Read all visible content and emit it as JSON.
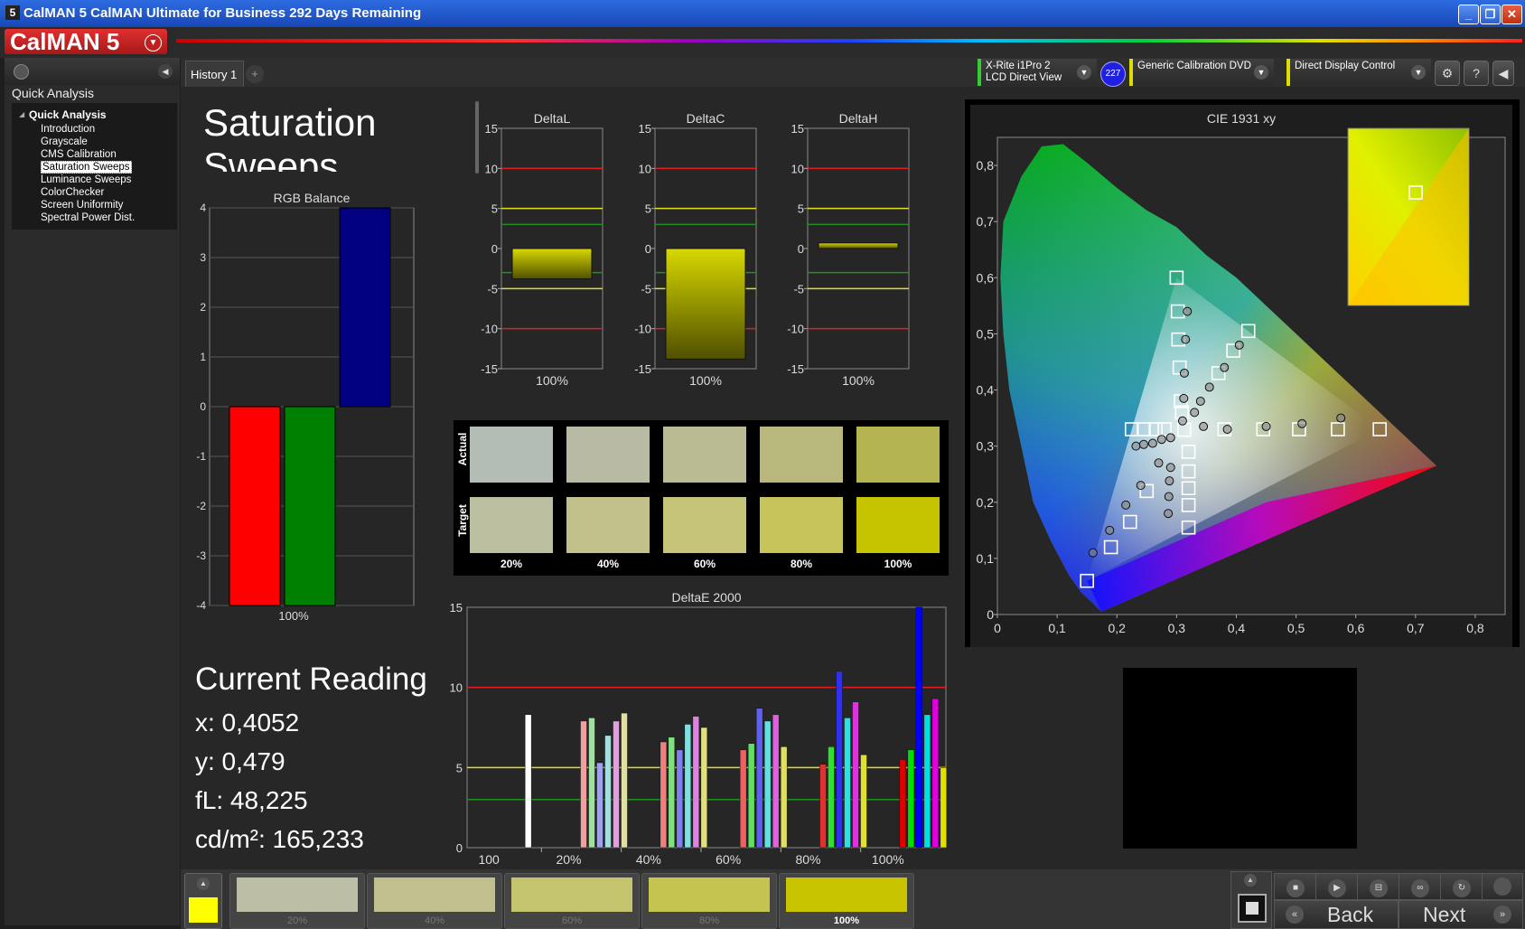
{
  "window": {
    "title": "CalMAN 5 CalMAN Ultimate for Business 292 Days Remaining",
    "icon_text": "5",
    "controls": [
      "minimize-icon",
      "restore-icon",
      "close-icon"
    ]
  },
  "app": {
    "logo": "CalMAN 5",
    "logo_dropdown_icon": "chevron-down-icon"
  },
  "sidebar": {
    "heading": "Quick Analysis",
    "tree_root": "Quick Analysis",
    "items": [
      {
        "label": "Introduction",
        "selected": false
      },
      {
        "label": "Grayscale",
        "selected": false
      },
      {
        "label": "CMS Calibration",
        "selected": false
      },
      {
        "label": "Saturation Sweeps",
        "selected": true
      },
      {
        "label": "Luminance Sweeps",
        "selected": false
      },
      {
        "label": "ColorChecker",
        "selected": false
      },
      {
        "label": "Screen Uniformity",
        "selected": false
      },
      {
        "label": "Spectral Power Dist.",
        "selected": false
      }
    ]
  },
  "tabs": {
    "history": "History 1",
    "add": "+"
  },
  "devices": {
    "meter_line1": "X-Rite i1Pro 2",
    "meter_line2": "LCD Direct View",
    "meter_badge": "227",
    "source": "Generic Calibration DVD",
    "display": "Direct Display Control",
    "icons": [
      "gear-icon",
      "help-icon",
      "collapse-icon"
    ],
    "help_label": "?"
  },
  "page": {
    "title": "Saturation Sweeps",
    "reading_title": "Current Reading",
    "readings": {
      "x": "x: 0,4052",
      "y": "y: 0,479",
      "fL": "fL: 48,225",
      "cdm2": "cd/m²: 165,233"
    }
  },
  "chart_data": [
    {
      "id": "rgb_balance",
      "type": "bar",
      "title": "RGB Balance",
      "categories": [
        "100%"
      ],
      "ylim": [
        -4,
        4
      ],
      "yticks": [
        "4",
        "3",
        "2",
        "1",
        "0",
        "-1",
        "-2",
        "-3",
        "-4"
      ],
      "series": [
        {
          "color": "#ff0000",
          "values": [
            -4.0
          ]
        },
        {
          "color": "#008000",
          "values": [
            -4.0
          ]
        },
        {
          "color": "#000080",
          "values": [
            4.0
          ]
        }
      ]
    },
    {
      "id": "delta_l",
      "type": "bar",
      "title": "DeltaL",
      "categories": [
        "100%"
      ],
      "values": [
        -3.8
      ],
      "ylim": [
        -15,
        15
      ],
      "yticks": [
        "15",
        "10",
        "5",
        "0",
        "-5",
        "-10",
        "-15"
      ]
    },
    {
      "id": "delta_c",
      "type": "bar",
      "title": "DeltaC",
      "categories": [
        "100%"
      ],
      "values": [
        -13.8
      ],
      "ylim": [
        -15,
        15
      ],
      "yticks": [
        "15",
        "10",
        "5",
        "0",
        "-5",
        "-10",
        "-15"
      ]
    },
    {
      "id": "delta_h",
      "type": "bar",
      "title": "DeltaH",
      "categories": [
        "100%"
      ],
      "values": [
        0.7
      ],
      "ylim": [
        -15,
        15
      ],
      "yticks": [
        "15",
        "10",
        "5",
        "0",
        "-5",
        "-10",
        "-15"
      ]
    },
    {
      "id": "delta_e_2000",
      "type": "bar",
      "title": "DeltaE 2000",
      "categories": [
        "100",
        "20%",
        "40%",
        "60%",
        "80%",
        "100%"
      ],
      "ylim": [
        0,
        15
      ],
      "yticks": [
        "15",
        "10",
        "5",
        "0"
      ],
      "groups": [
        {
          "colors": [
            "#ffffff"
          ],
          "values": [
            8.3
          ]
        },
        {
          "colors": [
            "#f0a0a0",
            "#a0e0a0",
            "#a0a0f0",
            "#a0e0e0",
            "#e0a0e0",
            "#e0e0a0"
          ],
          "values": [
            7.9,
            8.1,
            5.3,
            7.0,
            7.9,
            8.4
          ]
        },
        {
          "colors": [
            "#f08080",
            "#80e080",
            "#8080f0",
            "#80e0e0",
            "#e080e0",
            "#e0e080"
          ],
          "values": [
            6.6,
            6.9,
            6.1,
            7.7,
            8.2,
            7.5
          ]
        },
        {
          "colors": [
            "#f06060",
            "#60e060",
            "#6060f0",
            "#60e0e0",
            "#e060e0",
            "#e0e060"
          ],
          "values": [
            6.1,
            6.5,
            8.7,
            7.9,
            8.3,
            6.3
          ]
        },
        {
          "colors": [
            "#e03030",
            "#30e030",
            "#3030f0",
            "#30e0e0",
            "#e030e0",
            "#e0e030"
          ],
          "values": [
            5.2,
            6.3,
            11.0,
            8.1,
            9.1,
            5.8
          ]
        },
        {
          "colors": [
            "#e00000",
            "#00e000",
            "#0000ff",
            "#00e0e0",
            "#e000e0",
            "#e0e000"
          ],
          "values": [
            5.5,
            6.1,
            15.0,
            8.3,
            9.3,
            5.0
          ]
        }
      ]
    },
    {
      "id": "cie_1931_xy",
      "type": "scatter",
      "title": "CIE 1931 xy",
      "xlim": [
        0,
        0.85
      ],
      "ylim": [
        0,
        0.85
      ],
      "xticks": [
        "0",
        "0,1",
        "0,2",
        "0,3",
        "0,4",
        "0,5",
        "0,6",
        "0,7",
        "0,8"
      ],
      "yticks": [
        "0,8",
        "0,7",
        "0,6",
        "0,5",
        "0,4",
        "0,3",
        "0,2",
        "0,1",
        "0"
      ],
      "series": [
        {
          "marker": "square",
          "points": [
            [
              0.3127,
              0.329
            ],
            [
              0.64,
              0.33
            ],
            [
              0.57,
              0.33
            ],
            [
              0.505,
              0.33
            ],
            [
              0.445,
              0.33
            ],
            [
              0.38,
              0.33
            ],
            [
              0.3,
              0.6
            ],
            [
              0.302,
              0.54
            ],
            [
              0.303,
              0.49
            ],
            [
              0.305,
              0.44
            ],
            [
              0.307,
              0.38
            ],
            [
              0.309,
              0.36
            ],
            [
              0.15,
              0.06
            ],
            [
              0.19,
              0.12
            ],
            [
              0.222,
              0.165
            ],
            [
              0.25,
              0.22
            ],
            [
              0.28,
              0.33
            ],
            [
              0.265,
              0.33
            ],
            [
              0.245,
              0.33
            ],
            [
              0.225,
              0.33
            ],
            [
              0.42,
              0.505
            ],
            [
              0.395,
              0.47
            ],
            [
              0.37,
              0.43
            ],
            [
              0.32,
              0.155
            ],
            [
              0.32,
              0.195
            ],
            [
              0.32,
              0.225
            ],
            [
              0.32,
              0.255
            ],
            [
              0.32,
              0.29
            ]
          ]
        },
        {
          "marker": "circle",
          "points": [
            [
              0.318,
              0.54
            ],
            [
              0.315,
              0.49
            ],
            [
              0.313,
              0.43
            ],
            [
              0.312,
              0.385
            ],
            [
              0.31,
              0.345
            ],
            [
              0.345,
              0.335
            ],
            [
              0.385,
              0.33
            ],
            [
              0.45,
              0.335
            ],
            [
              0.51,
              0.34
            ],
            [
              0.575,
              0.35
            ],
            [
              0.232,
              0.3
            ],
            [
              0.245,
              0.303
            ],
            [
              0.26,
              0.305
            ],
            [
              0.275,
              0.312
            ],
            [
              0.29,
              0.315
            ],
            [
              0.27,
              0.27
            ],
            [
              0.24,
              0.23
            ],
            [
              0.215,
              0.195
            ],
            [
              0.188,
              0.15
            ],
            [
              0.16,
              0.11
            ],
            [
              0.29,
              0.262
            ],
            [
              0.288,
              0.238
            ],
            [
              0.287,
              0.21
            ],
            [
              0.286,
              0.18
            ],
            [
              0.33,
              0.36
            ],
            [
              0.34,
              0.38
            ],
            [
              0.355,
              0.405
            ],
            [
              0.38,
              0.44
            ],
            [
              0.405,
              0.48
            ]
          ]
        }
      ],
      "inset_point": [
        0.4052,
        0.479
      ]
    }
  ],
  "swatches": {
    "row_actual": "Actual",
    "row_target": "Target",
    "labels": [
      "20%",
      "40%",
      "60%",
      "80%",
      "100%"
    ],
    "actual_colors": [
      "#b4bcb6",
      "#b9baa3",
      "#babb93",
      "#b8b87c",
      "#b4b450"
    ],
    "target_colors": [
      "#bcbea0",
      "#c2c18c",
      "#c5c479",
      "#c6c45a",
      "#c6c400"
    ]
  },
  "bottom": {
    "current_swatch_color": "#ffff00",
    "patches": [
      {
        "label": "20%",
        "color": "#bcbea6",
        "active": false
      },
      {
        "label": "40%",
        "color": "#c0c08e",
        "active": false
      },
      {
        "label": "60%",
        "color": "#c4c46e",
        "active": false
      },
      {
        "label": "80%",
        "color": "#c4c44e",
        "active": false
      },
      {
        "label": "100%",
        "color": "#c8c400",
        "active": true
      }
    ],
    "back_label": "Back",
    "next_label": "Next",
    "controls": [
      "stop-icon",
      "play-icon",
      "measure-icon",
      "loop-icon",
      "refresh-icon",
      "record-icon"
    ]
  }
}
